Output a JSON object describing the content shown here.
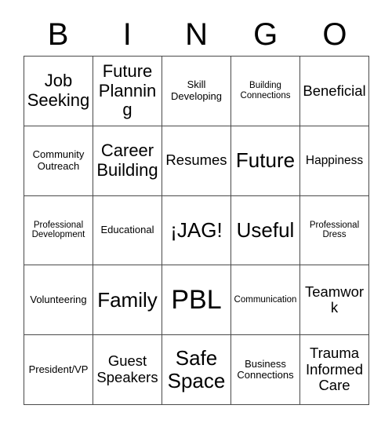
{
  "card": {
    "header_letters": [
      "B",
      "I",
      "N",
      "G",
      "O"
    ],
    "rows": [
      [
        {
          "text": "Job Seeking",
          "size": "fs-xl"
        },
        {
          "text": "Future Planning",
          "size": "fs-xl"
        },
        {
          "text": "Skill Developing",
          "size": "fs-s"
        },
        {
          "text": "Building Connections",
          "size": "fs-xs"
        },
        {
          "text": "Beneficial",
          "size": "fs-l"
        }
      ],
      [
        {
          "text": "Community Outreach",
          "size": "fs-s"
        },
        {
          "text": "Career Building",
          "size": "fs-xl"
        },
        {
          "text": "Resumes",
          "size": "fs-l"
        },
        {
          "text": "Future",
          "size": "fs-xxl"
        },
        {
          "text": "Happiness",
          "size": "fs-m"
        }
      ],
      [
        {
          "text": "Professional Development",
          "size": "fs-xs"
        },
        {
          "text": "Educational",
          "size": "fs-s"
        },
        {
          "text": "¡JAG!",
          "size": "fs-xxl"
        },
        {
          "text": "Useful",
          "size": "fs-xxl"
        },
        {
          "text": "Professional Dress",
          "size": "fs-xs"
        }
      ],
      [
        {
          "text": "Volunteering",
          "size": "fs-s"
        },
        {
          "text": "Family",
          "size": "fs-xxl"
        },
        {
          "text": "PBL",
          "size": "fs-huge"
        },
        {
          "text": "Communication",
          "size": "fs-xs"
        },
        {
          "text": "Teamwork",
          "size": "fs-l"
        }
      ],
      [
        {
          "text": "President/VP",
          "size": "fs-s"
        },
        {
          "text": "Guest Speakers",
          "size": "fs-l"
        },
        {
          "text": "Safe Space",
          "size": "fs-xxl"
        },
        {
          "text": "Business Connections",
          "size": "fs-s"
        },
        {
          "text": "Trauma Informed Care",
          "size": "fs-l"
        }
      ]
    ],
    "colors": {
      "border": "#4a4a4a",
      "text": "#000000",
      "background": "#ffffff"
    }
  }
}
